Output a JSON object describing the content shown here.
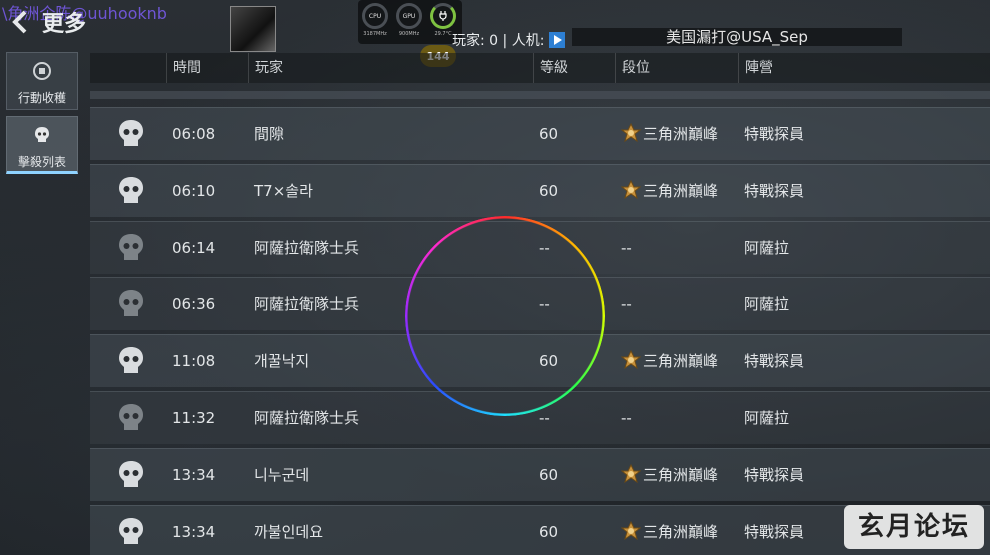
{
  "header": {
    "back_label": "",
    "title": "更多",
    "watermark": "\\角洲企陈@uuhooknb",
    "players_label": "玩家: 0 | 人机:",
    "server_banner": "美国漏打@USA_Sep",
    "fps": "144"
  },
  "overlay": {
    "gauges": [
      {
        "label": "CPU",
        "sub": "3187MHz"
      },
      {
        "label": "GPU",
        "sub": "900MHz"
      },
      {
        "label": "",
        "sub": "29.7°C"
      }
    ]
  },
  "sidebar": {
    "items": [
      {
        "label": "行動收穫",
        "icon": "action-harvest-icon",
        "active": false
      },
      {
        "label": "擊殺列表",
        "icon": "skull-icon",
        "active": true
      }
    ]
  },
  "table": {
    "columns": [
      "時間",
      "玩家",
      "等級",
      "段位",
      "陣營"
    ],
    "rows": [
      {
        "time": "06:08",
        "player": "間隙",
        "level": "60",
        "rank": "三角洲巔峰",
        "faction": "特戰探員",
        "human": true
      },
      {
        "time": "06:10",
        "player": "T7×솔라",
        "level": "60",
        "rank": "三角洲巔峰",
        "faction": "特戰探員",
        "human": true
      },
      {
        "time": "06:14",
        "player": "阿薩拉衛隊士兵",
        "level": "--",
        "rank": "--",
        "faction": "阿薩拉",
        "human": false
      },
      {
        "time": "06:36",
        "player": "阿薩拉衛隊士兵",
        "level": "--",
        "rank": "--",
        "faction": "阿薩拉",
        "human": false
      },
      {
        "time": "11:08",
        "player": "개꿀낙지",
        "level": "60",
        "rank": "三角洲巔峰",
        "faction": "特戰探員",
        "human": true
      },
      {
        "time": "11:32",
        "player": "阿薩拉衛隊士兵",
        "level": "--",
        "rank": "--",
        "faction": "阿薩拉",
        "human": false
      },
      {
        "time": "13:34",
        "player": "니누군데",
        "level": "60",
        "rank": "三角洲巔峰",
        "faction": "特戰探員",
        "human": true
      },
      {
        "time": "13:34",
        "player": "까불인데요",
        "level": "60",
        "rank": "三角洲巔峰",
        "faction": "特戰探員",
        "human": true
      }
    ]
  },
  "forum_watermark": "玄月论坛"
}
